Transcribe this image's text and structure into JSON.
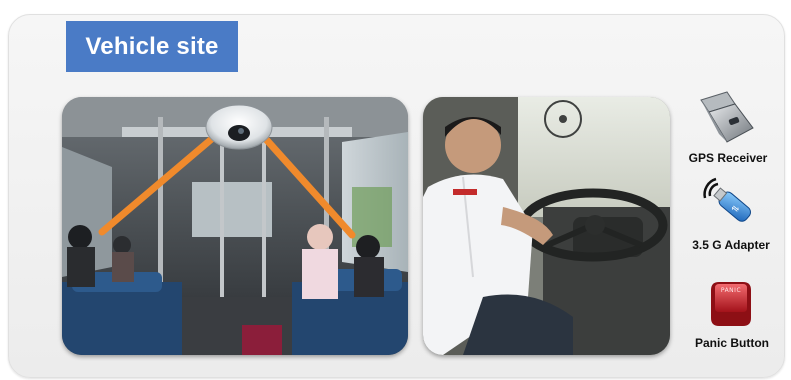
{
  "header": {
    "title": "Vehicle site"
  },
  "photos": {
    "interior_icon": "bus-interior-dome-camera-photo",
    "driver_icon": "bus-driver-steering-wheel-photo"
  },
  "devices": [
    {
      "label": "GPS Receiver",
      "icon": "gps-receiver-icon"
    },
    {
      "label": "3.5 G Adapter",
      "icon": "usb-3g-adapter-icon"
    },
    {
      "label": "Panic Button",
      "icon": "panic-button-icon",
      "key_text": "PANIC"
    }
  ],
  "colors": {
    "title_bg": "#4a7bc6",
    "coverage_lines": "#f08a2c",
    "panic_red": "#d4232a"
  }
}
